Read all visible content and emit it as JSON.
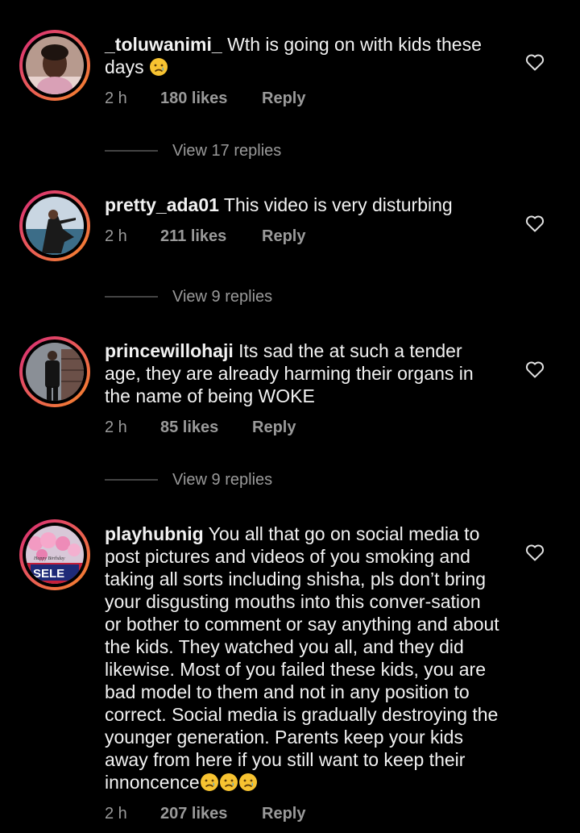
{
  "comments": [
    {
      "username": "_toluwanimi_",
      "text": "Wth is going on with kids these days",
      "emoji": "crying-face-icon",
      "time": "2 h",
      "likes": "180 likes",
      "reply": "Reply",
      "view_replies": "View 17 replies"
    },
    {
      "username": "pretty_ada01",
      "text": "This video is very disturbing",
      "time": "2 h",
      "likes": "211 likes",
      "reply": "Reply",
      "view_replies": "View 9 replies"
    },
    {
      "username": "princewillohaji",
      "text": "Its sad the at such a tender age, they are already harming their organs in the name of being WOKE",
      "time": "2 h",
      "likes": "85 likes",
      "reply": "Reply",
      "view_replies": "View 9 replies"
    },
    {
      "username": "playhubnig",
      "text": "You all that go on social media to post pictures and videos of you smoking and taking all sorts including shisha, pls don’t bring your disgusting mouths into this conver-sation or bother to comment or say anything and about the kids. They watched you all, and they did likewise. Most of you failed these kids, you are bad model to them and not in any position to correct. Social media is gradually destroying the younger generation. Parents keep your kids away from here if you still want to keep their innoncence",
      "emoji": "crying-face-icon",
      "time": "2 h",
      "likes": "207 likes",
      "reply": "Reply",
      "avatar_text": "SELE",
      "avatar_small_text": "Happy Birthday"
    }
  ],
  "colors": {
    "background": "#000000",
    "text": "#f2f2f2",
    "muted": "#9a9a9a",
    "ring_start": "#d62976",
    "ring_end": "#f58529"
  }
}
